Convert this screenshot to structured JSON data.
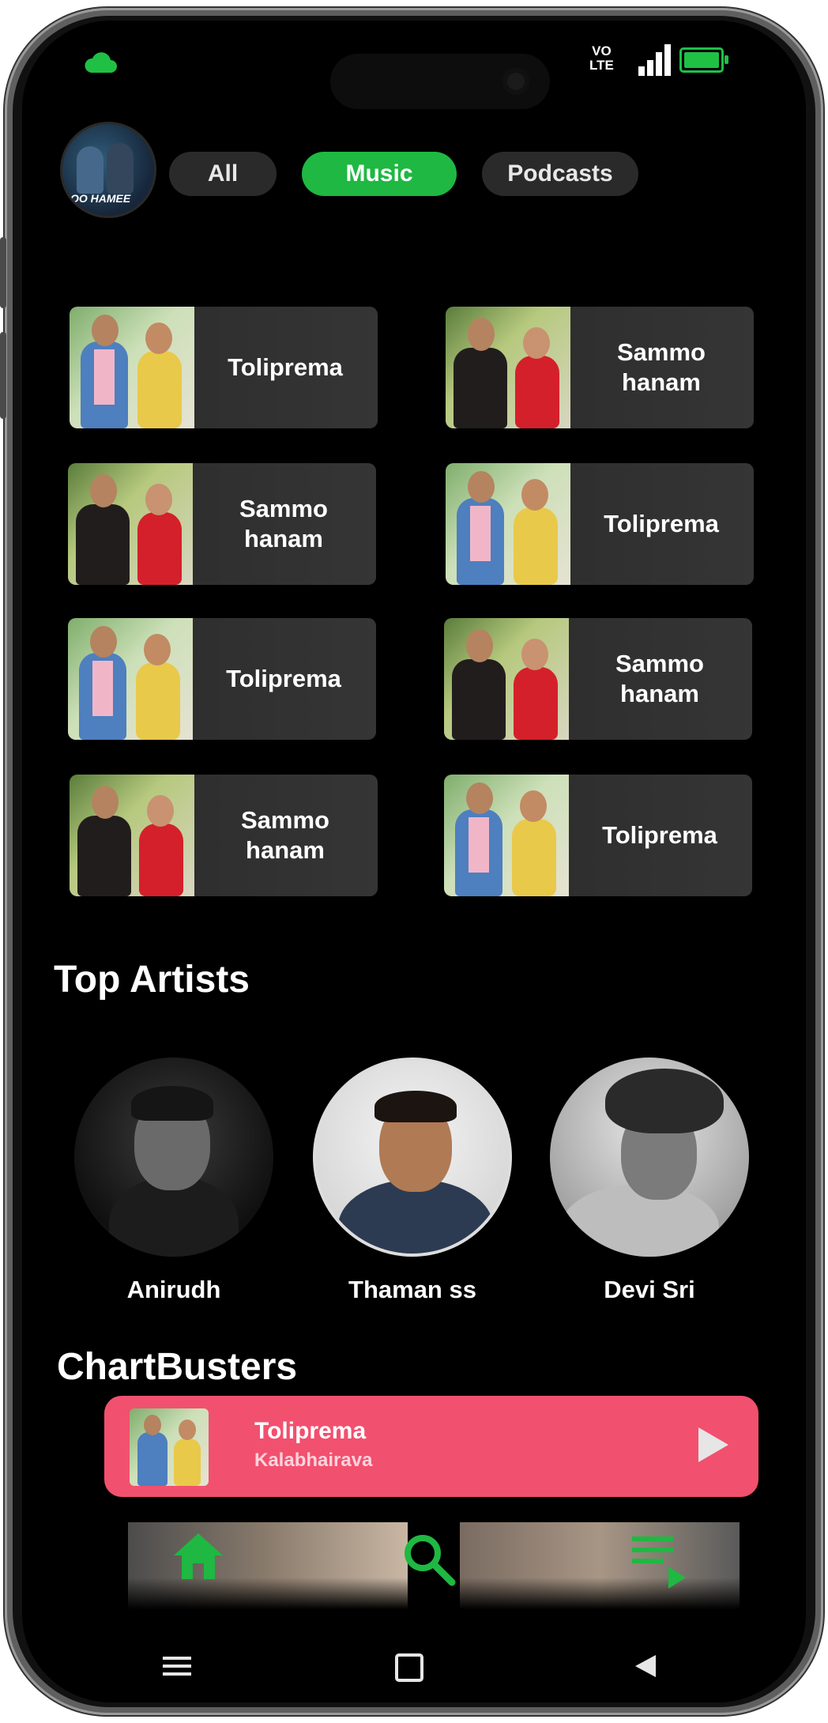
{
  "status_bar": {
    "network_label": "VO\nLTE"
  },
  "filters": [
    {
      "label": "All",
      "active": false
    },
    {
      "label": "Music",
      "active": true
    },
    {
      "label": "Podcasts",
      "active": false
    }
  ],
  "avatar": {
    "caption": "OO HAMEE"
  },
  "quick_picks": [
    {
      "label": "Toliprema"
    },
    {
      "label": "Sammo\nhanam"
    },
    {
      "label": "Sammo\nhanam"
    },
    {
      "label": "Toliprema"
    },
    {
      "label": "Toliprema"
    },
    {
      "label": "Sammo\nhanam"
    },
    {
      "label": "Sammo\nhanam"
    },
    {
      "label": "Toliprema"
    }
  ],
  "top_artists": {
    "title": "Top Artists",
    "artists": [
      {
        "name": "Anirudh"
      },
      {
        "name": "Thaman ss"
      },
      {
        "name": "Devi Sri"
      }
    ]
  },
  "chartbusters": {
    "title": "ChartBusters"
  },
  "now_playing": {
    "title": "Toliprema",
    "artist": "Kalabhairava"
  },
  "bottom_nav": [
    "home-icon",
    "search-icon",
    "queue-music-icon"
  ],
  "colors": {
    "accent": "#1fb842",
    "player": "#f2506f",
    "background": "#000000"
  }
}
